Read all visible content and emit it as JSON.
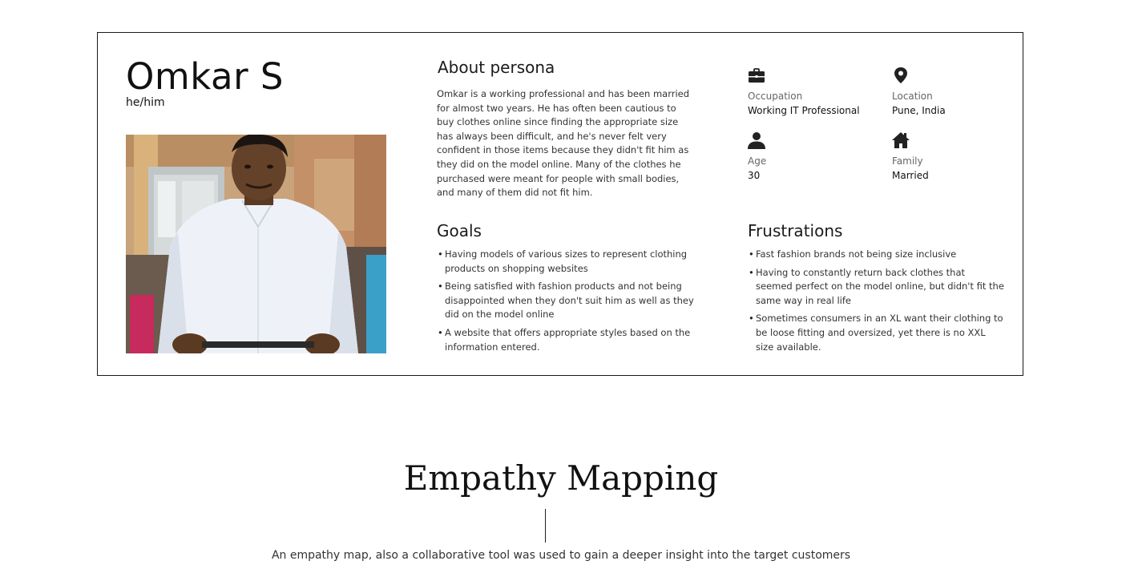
{
  "persona": {
    "name": "Omkar S",
    "pronouns": "he/him",
    "about": {
      "title": "About persona",
      "text": "Omkar is a working professional and has been married for almost two years. He has often been cautious to buy clothes online since finding the appropriate size has always been difficult, and he's never felt very confident in those items because they didn't fit him as they did on the model online. Many of the clothes he purchased were meant for people with small bodies, and many of them did not fit him."
    },
    "details": {
      "occupation": {
        "label": "Occupation",
        "value": "Working IT Professional",
        "icon": "briefcase-icon"
      },
      "location": {
        "label": "Location",
        "value": "Pune, India",
        "icon": "map-pin-icon"
      },
      "age": {
        "label": "Age",
        "value": "30",
        "icon": "person-icon"
      },
      "family": {
        "label": "Family",
        "value": "Married",
        "icon": "home-icon"
      }
    },
    "goals": {
      "title": "Goals",
      "items": [
        "Having models of various sizes to represent clothing products on shopping websites",
        "Being satisfied with fashion products and not being disappointed when they don't suit him as well as they did on the model online",
        "A website that offers appropriate styles based on the information entered."
      ]
    },
    "frustrations": {
      "title": "Frustrations",
      "items": [
        "Fast fashion brands not being size inclusive",
        "Having to constantly return back clothes that seemed perfect on the model online, but didn't fit the same way in real life",
        "Sometimes consumers in an XL want their clothing to be loose fitting and oversized, yet there is no XXL size available."
      ]
    }
  },
  "empathy": {
    "title": "Empathy Mapping",
    "description": "An empathy map, also a collaborative tool was used to gain a deeper insight into the target customers"
  },
  "colors": {
    "text": "#111111",
    "muted": "#666666",
    "border": "#1a1a1a",
    "shirt": "#eef2f8"
  }
}
